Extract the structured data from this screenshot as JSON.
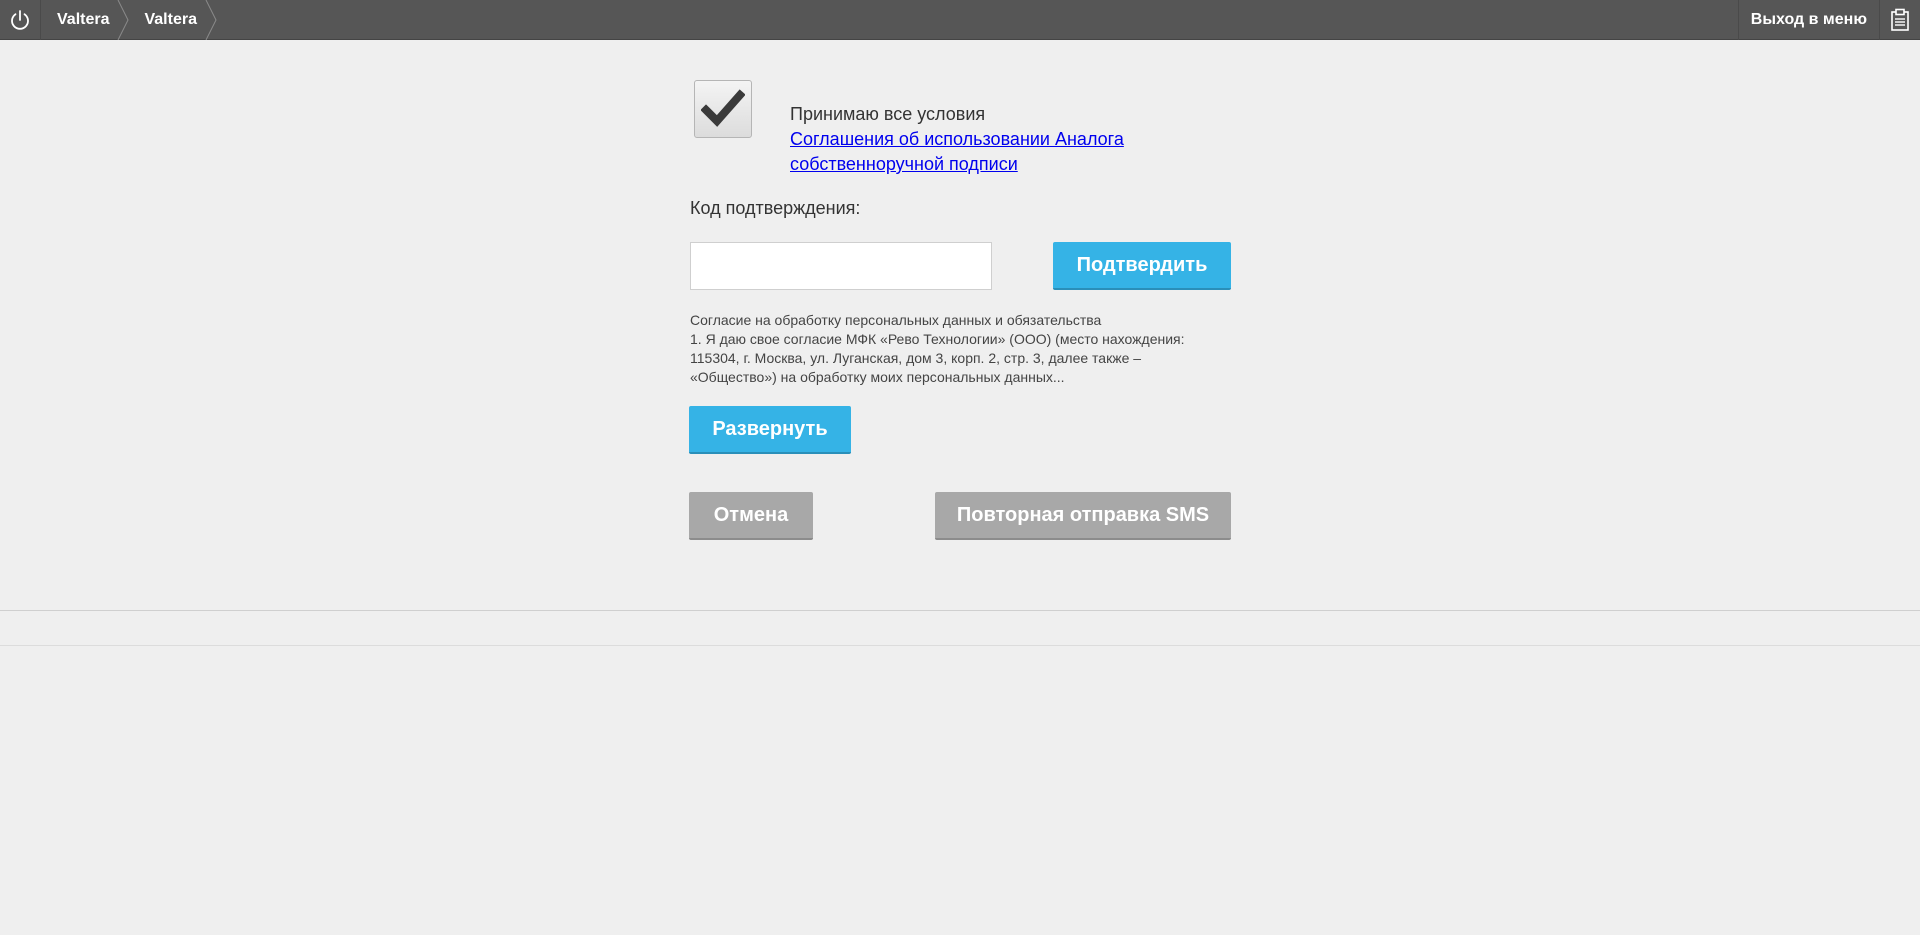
{
  "topbar": {
    "breadcrumbs": [
      "Valtera",
      "Valtera"
    ],
    "exit_label": "Выход в меню"
  },
  "form": {
    "checkbox_checked": true,
    "accept_text": "Принимаю все условия",
    "agreement_link": "Соглашения об использовании Аналога собственноручной подписи",
    "code_label": "Код подтверждения:",
    "code_value": "",
    "confirm_label": "Подтвердить",
    "consent_title": "Согласие на обработку персональных данных и обязательства",
    "consent_body": "1. Я даю свое согласие МФК «Рево Технологии» (ООО) (место нахождения: 115304, г. Москва, ул. Луганская, дом 3, корп. 2, стр. 3, далее также – «Общество») на обработку моих персональных данных...",
    "expand_label": "Развернуть",
    "cancel_label": "Отмена",
    "resend_label": "Повторная отправка SMS"
  },
  "icons": {
    "power": "power-icon",
    "clipboard": "clipboard-icon",
    "check": "check-icon"
  },
  "colors": {
    "topbar": "#565656",
    "primary_button": "#35b3e6",
    "secondary_button": "#a8a8a8",
    "link": "#0000ee"
  }
}
